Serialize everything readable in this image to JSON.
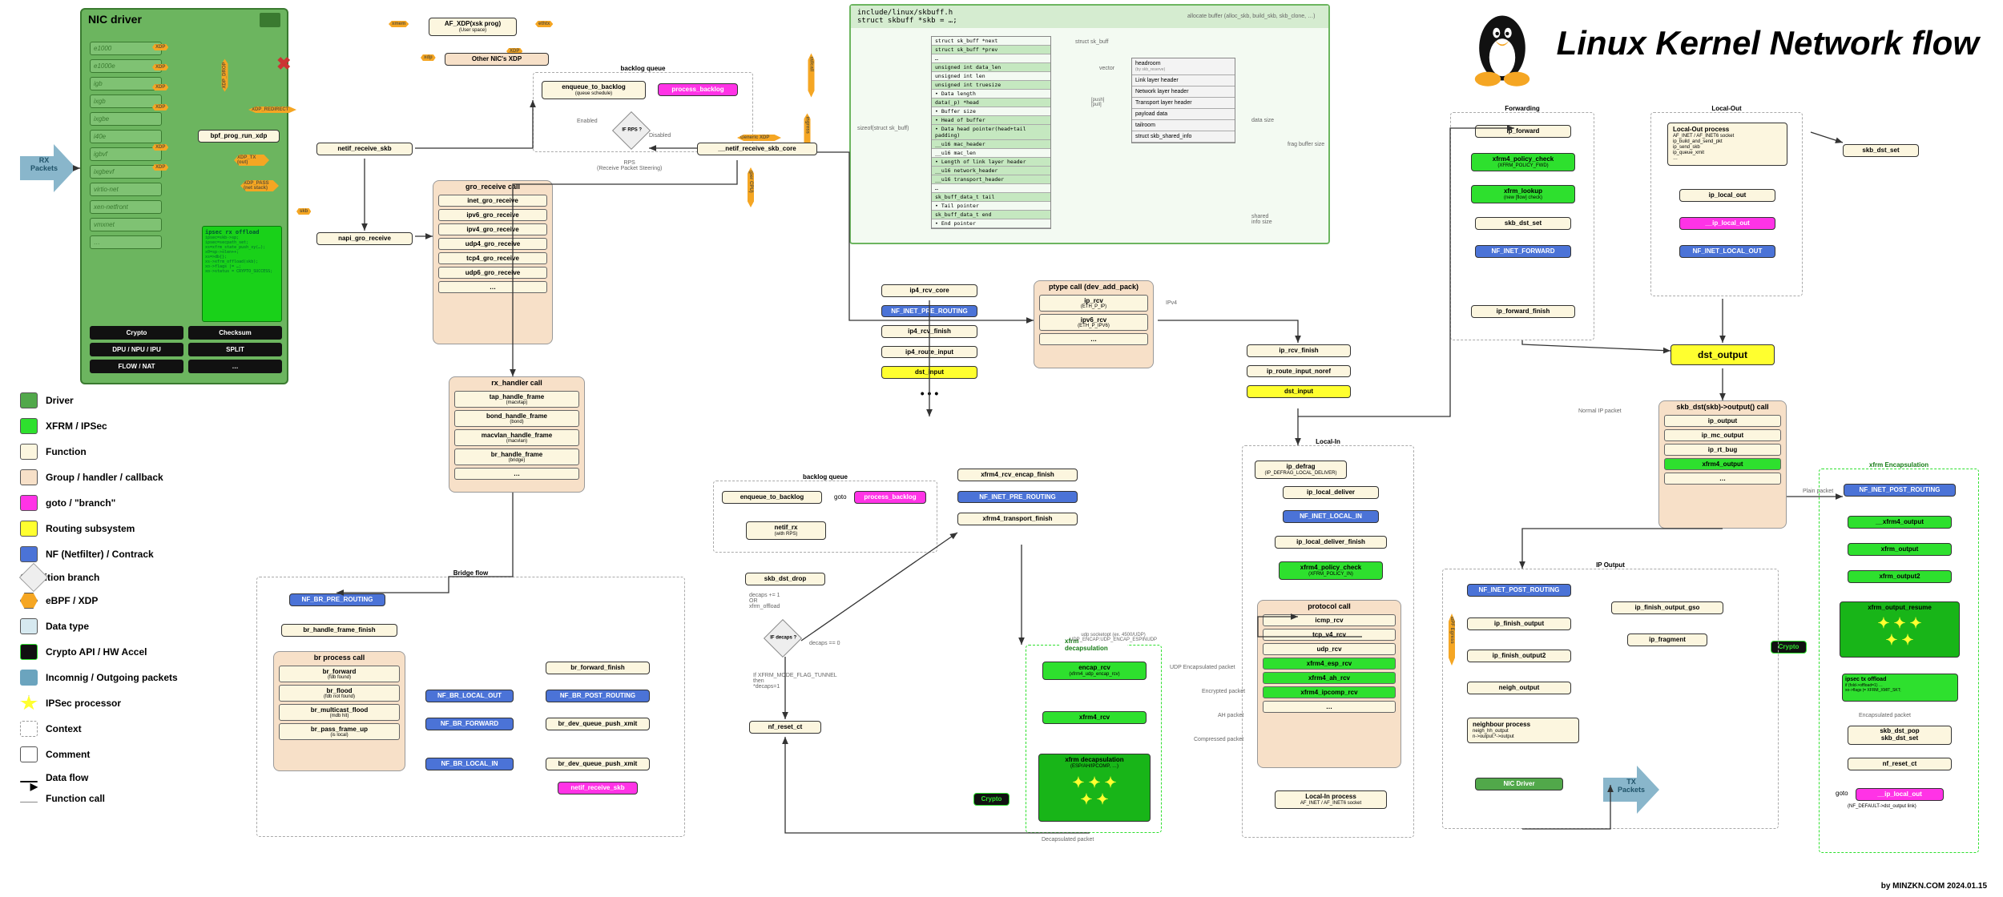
{
  "title": "Linux Kernel Network flow",
  "credit": "by MINZKN.COM 2024.01.15",
  "legend": [
    {
      "label": "Driver",
      "bg": "#51a84a"
    },
    {
      "label": "XFRM / IPSec",
      "bg": "#2ee02e"
    },
    {
      "label": "Function",
      "bg": "#fcf6df"
    },
    {
      "label": "Group / handler / callback",
      "bg": "#f7e0c8"
    },
    {
      "label": "goto / \"branch\"",
      "bg": "#ff33e6"
    },
    {
      "label": "Routing subsystem",
      "bg": "#ffff2f"
    },
    {
      "label": "NF (Netfilter) / Contrack",
      "bg": "#4b73d7"
    },
    {
      "label": "Condition branch",
      "bg": "#eeeeee",
      "shape": "diamond"
    },
    {
      "label": "eBPF / XDP",
      "bg": "#f5a623",
      "shape": "hex"
    },
    {
      "label": "Data type",
      "bg": "#d6e9f0"
    },
    {
      "label": "Crypto API / HW Accel",
      "bg": "#111111",
      "fg": "#2ee02e"
    },
    {
      "label": "Incomnig / Outgoing packets",
      "bg": "#6ba4be",
      "shape": "arrow"
    },
    {
      "label": "IPSec processor",
      "bg": "#ffff2f",
      "shape": "star"
    },
    {
      "label": "Context",
      "bg": "#ffffff",
      "dashed": true
    },
    {
      "label": "Comment",
      "bg": "#ffffff"
    },
    {
      "label": "Data flow",
      "bg": "",
      "line": "bold"
    },
    {
      "label": "Function call",
      "bg": "",
      "line": "thin"
    }
  ],
  "nic": {
    "title": "NIC driver",
    "drivers": [
      "e1000",
      "e1000e",
      "igb",
      "ixgb",
      "ixgbe",
      "i40e",
      "igbvf",
      "ixgbevf",
      "virtio-net",
      "xen-netfront",
      "vmxnet",
      "…"
    ],
    "features": [
      [
        "Crypto",
        "Checksum"
      ],
      [
        "DPU / NPU / IPU",
        "SPLIT"
      ],
      [
        "FLOW / NAT",
        "…"
      ]
    ],
    "offload_title": "ipsec rx offload",
    "offload_body": "ipsec=skb->sp;\\nipsec=secpath_set;\\nxs=xfrm_state_push_xy(…);\\nx0=sp->olen++;\\nxs=>db{};\\nxs->xfrm_offload(skb);\\nxo->flags |= …;\\nxo->status = CRYPTO_SUCCESS;",
    "bpf": "bpf_prog_run_xdp",
    "xdp_tags": [
      "XDP",
      "XDP_TX (out)",
      "XDP_PASS (net stack)",
      "XDP_REDIRECT",
      "skb",
      "XDP_DROP"
    ]
  },
  "top_xdp": {
    "af_xdp": "AF_XDP(xsk prog)",
    "af_xdp_sub": "(User space)",
    "other_nic": "Other NIC's XDP",
    "tags": [
      "xmem",
      "ethtx",
      "XDP",
      "tailcall",
      "xdp"
    ]
  },
  "backlog1": {
    "title": "backlog queue",
    "enqueue": "enqueue_to_backlog",
    "enqueue_sub": "(queue schedule)",
    "goto": "process_backlog",
    "hooks": [
      "Enabled",
      "Disabled",
      "ingress",
      "Generic XDP"
    ]
  },
  "netif_rcv": "netif_receive_skb",
  "if_rps": "IF RPS ?",
  "rps_comment": "RPS\\n(Receive Packet Steering)",
  "netif_rcv_core": "__netif_receive_skb_core",
  "napi_gro": "napi_gro_receive",
  "gro": {
    "title": "gro_receive call",
    "items": [
      "inet_gro_receive",
      "ipv6_gro_receive",
      "ipv4_gro_receive",
      "udp4_gro_receive",
      "tcp4_gro_receive",
      "udp6_gro_receive",
      "…"
    ]
  },
  "rx_handler": {
    "title": "rx_handler call",
    "items": [
      {
        "label": "tap_handle_frame",
        "sub": "(macvtap)"
      },
      {
        "label": "bond_handle_frame",
        "sub": "(bond)"
      },
      {
        "label": "macvlan_handle_frame",
        "sub": "(macvlan)"
      },
      {
        "label": "br_handle_frame",
        "sub": "(bridge)"
      },
      {
        "label": "…"
      }
    ]
  },
  "bridge": {
    "title": "Bridge flow",
    "pre_routing": "NF_BR_PRE_ROUTING",
    "finish": "br_handle_frame_finish",
    "process_title": "br process call",
    "process": [
      {
        "label": "br_forward",
        "sub": "(fdb found)"
      },
      {
        "label": "br_flood",
        "sub": "(fdb not found)"
      },
      {
        "label": "br_multicast_flood",
        "sub": "(mdb hit)"
      },
      {
        "label": "br_pass_frame_up",
        "sub": "(is local)"
      }
    ],
    "right_nf": [
      "NF_BR_LOCAL_OUT",
      "NF_BR_FORWARD",
      "NF_BR_LOCAL_IN"
    ],
    "fwd_finish": "br_forward_finish",
    "post_routing": "NF_BR_POST_ROUTING",
    "dev_queue": "br_dev_queue_push_xmit",
    "dev_queue2": "br_dev_queue_push_xmit",
    "goto_netif": "netif_receive_skb"
  },
  "ptype": {
    "title": "ptype call (dev_add_pack)",
    "items": [
      {
        "label": "ip_rcv",
        "sub": "(ETH_P_IP)"
      },
      {
        "label": "ipv6_rcv",
        "sub": "(ETH_P_IPV6)"
      },
      {
        "label": "…"
      }
    ],
    "ipv4_tag": "IPv4"
  },
  "ip4_col": {
    "items": [
      "ip4_rcv_core",
      "NF_INET_PRE_ROUTING",
      "ip4_rcv_finish",
      "ip4_route_input",
      "dst_input"
    ],
    "ellipsis": "• • •"
  },
  "right_route": {
    "items": [
      "ip_rcv_finish",
      "ip_route_input_noref",
      "dst_input"
    ]
  },
  "local_in": {
    "title": "Local-In",
    "defrag": "ip_defrag",
    "defrag_sub": "(IP_DEFRAG_LOCAL_DELIVER)",
    "deliver": "ip_local_deliver",
    "nf": "NF_INET_LOCAL_IN",
    "finish": "ip_local_deliver_finish",
    "policy": "xfrm4_policy_check",
    "policy_sub": "(XFRM_POLICY_IN)"
  },
  "protocol": {
    "title": "protocol call",
    "items": [
      "icmp_rcv",
      "tcp_v4_rcv",
      "udp_rcv",
      "xfrm4_esp_rcv",
      "xfrm4_ah_rcv",
      "xfrm4_ipcomp_rcv",
      "…"
    ],
    "af_title": "Local-In process",
    "af_sub": "AF_INET / AF_INET6 socket"
  },
  "xfrm_decap": {
    "title": "xfrm decapsulation",
    "encap": "encap_rcv",
    "encap_sub": "(xfrm4_udp_encap_rcv)",
    "xfrm4_rcv": "xfrm4_rcv",
    "decap": "xfrm decapsulation",
    "decap_sub": "(ESP/AH/IPCOMP, …)",
    "labels": {
      "udp": "UDP Encapsulated packet",
      "enc": "Encrypted packet",
      "ah": "AH packet",
      "comp": "Compressed packet",
      "decap": "Decapsulated packet",
      "sockopt": "udp socketopt (ex. 4500/UDP)\\nUDP_ENCAP:UDP_ENCAP_ESPINUDP"
    }
  },
  "backlog2": {
    "title": "backlog queue",
    "enqueue": "enqueue_to_backlog",
    "goto_label": "goto",
    "goto": "process_backlog",
    "netif_rx": "netif_rx",
    "netif_rx_sub": "(with RPS)",
    "dst_drop": "skb_dst_drop",
    "decaps_comment": "decaps += 1\\nOR\\nxfrm_offload",
    "if_decaps": "IF decaps ?",
    "tunnel_comment": "If XFRM_MODE_FLAG_TUNNEL\\nthen\\n*decaps=1",
    "reset_ct": "nf_reset_ct",
    "decaps0": "decaps == 0"
  },
  "xfrm_mid": {
    "encap_finish": "xfrm4_rcv_encap_finish",
    "nf_pre": "NF_INET_PRE_ROUTING",
    "trans_finish": "xfrm4_transport_finish"
  },
  "forwarding": {
    "title": "Forwarding",
    "items": [
      "ip_forward",
      "xfrm4_policy_check",
      "xfrm_lookup",
      "skb_dst_set",
      "NF_INET_FORWARD",
      "ip_forward_finish"
    ],
    "policy_sub": "(XFRM_POLICY_FWD)",
    "lookup_sub": "(new [flow] check)"
  },
  "local_out": {
    "title": "Local-Out",
    "proc_title": "Local-Out process",
    "proc_sub": "AF_INET / AF_INET6 socket\\nip_build_and_send_pkt\\nip_send_skb\\nip_queue_xmit\\n…",
    "items": [
      "ip_local_out",
      "__ip_local_out",
      "NF_INET_LOCAL_OUT"
    ],
    "dst_set": "skb_dst_set",
    "dst_output": "dst_output"
  },
  "skb_dst_output": {
    "title": "skb_dst(skb)->output() call",
    "items": [
      "ip_output",
      "ip_mc_output",
      "ip_rt_bug",
      "xfrm4_output",
      "…"
    ],
    "normal": "Normal IP packet",
    "plain": "Plain packet"
  },
  "xfrm_encap": {
    "title": "xfrm Encapsulation",
    "nf": "NF_INET_POST_ROUTING",
    "items": [
      "__xfrm4_output",
      "xfrm_output",
      "xfrm_output2",
      "xfrm_output_resume"
    ],
    "crypto": "Crypto",
    "offload_title": "ipsec tx offload",
    "offload_body": "if (fold->offload=1)\\n…\\nxo->flags |= XFRM_XMIT_SKT;",
    "encap_label": "Encapsulated packet",
    "right_items": [
      "skb_dst_pop\\nskb_dst_set",
      "nf_reset_ct"
    ],
    "goto_label": "goto",
    "goto": "__ip_local_out",
    "goto_sub": "(NF_DEFAULT->dst_output link)"
  },
  "ip_output": {
    "title": "IP Output",
    "nf_post": "NF_INET_POST_ROUTING",
    "bpf_egress": "BPF Egress",
    "items": [
      "ip_finish_output",
      "ip_finish_output2",
      "neigh_output"
    ],
    "gso": "ip_finish_output_gso",
    "frag": "ip_fragment",
    "neigh_title": "neighbour process",
    "neigh_sub": "neigh_hh_output\\nn->output:*->output",
    "nic_driver": "NIC Driver",
    "tx": "TX\\nPackets"
  },
  "skbuff": {
    "path": "include/linux/skbuff.h",
    "decl": "struct skbuff *skb = …;",
    "alloc": "allocate buffer (alloc_skb, build_skb, skb_clone, …)",
    "struct_title": "struct sk_buff",
    "fields": [
      {
        "t": "struct sk_buff *next"
      },
      {
        "t": "struct sk_buff *prev",
        "g": 1
      },
      {
        "t": "…"
      },
      {
        "t": "unsigned int data_len",
        "g": 1
      },
      {
        "t": "unsigned int len"
      },
      {
        "t": "unsigned int truesize",
        "g": 1
      },
      {
        "t": "• Data length"
      },
      {
        "t": "data(_p) *head",
        "g": 1
      },
      {
        "t": "• Buffer size"
      },
      {
        "t": "• Head of buffer",
        "g": 1
      },
      {
        "t": "• Data head pointer(head+tail padding)",
        "g": 1
      },
      {
        "t": "__u16 mac_header",
        "g": 1
      },
      {
        "t": "__u16 mac_len"
      },
      {
        "t": "• Length of link layer header",
        "g": 1
      },
      {
        "t": "__u16 network_header",
        "g": 1
      },
      {
        "t": "__u16 transport_header",
        "g": 1
      },
      {
        "t": "…"
      },
      {
        "t": "sk_buff_data_t tail",
        "g": 1
      },
      {
        "t": "• Tail pointer"
      },
      {
        "t": "sk_buff_data_t end",
        "g": 1
      },
      {
        "t": "• End pointer"
      }
    ],
    "sizeof": "sizeof(struct sk_buff)",
    "vector": "vector",
    "ops": "[push]\\n[pull]",
    "frag_label": "frag buffer size",
    "chunks": [
      {
        "t": "headroom",
        "s": "(by skb_reserve)"
      },
      {
        "t": "Link layer header"
      },
      {
        "t": "Network layer header"
      },
      {
        "t": "Transport layer header"
      },
      {
        "t": "payload data"
      },
      {
        "t": "tailroom"
      },
      {
        "t": "struct skb_shared_info"
      }
    ],
    "data_size": "data size",
    "shared": "shared\\ninfo size"
  },
  "rx_label": "RX\\nPackets"
}
